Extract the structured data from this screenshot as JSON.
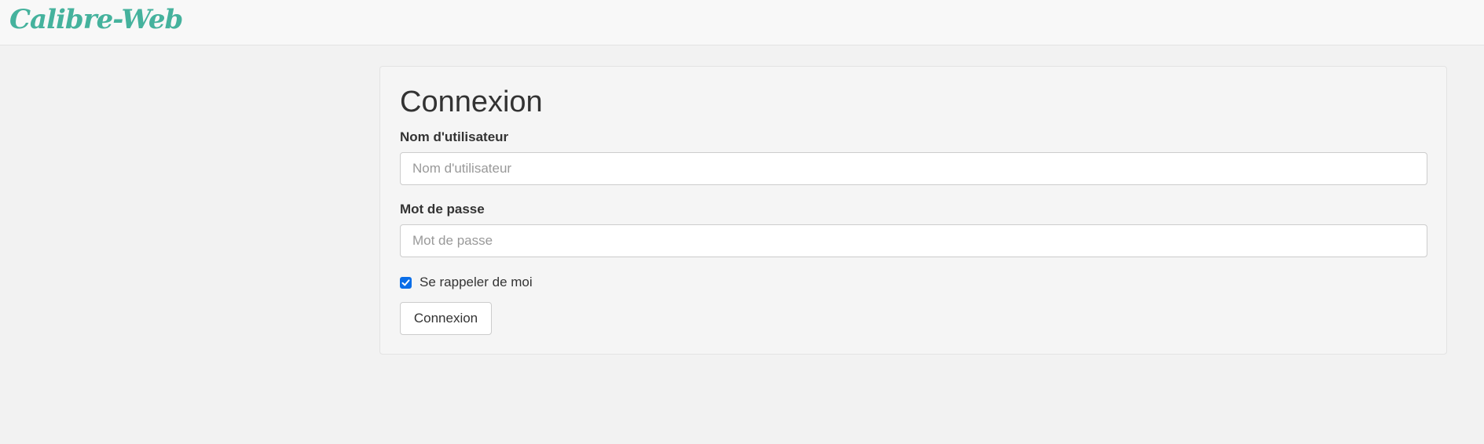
{
  "header": {
    "brand": "Calibre-Web",
    "brand_color": "#45b29d"
  },
  "login_form": {
    "title": "Connexion",
    "username": {
      "label": "Nom d'utilisateur",
      "placeholder": "Nom d'utilisateur",
      "value": ""
    },
    "password": {
      "label": "Mot de passe",
      "placeholder": "Mot de passe",
      "value": ""
    },
    "remember_me": {
      "label": "Se rappeler de moi",
      "checked": true,
      "check_color": "#0b6ee8"
    },
    "submit_label": "Connexion"
  }
}
